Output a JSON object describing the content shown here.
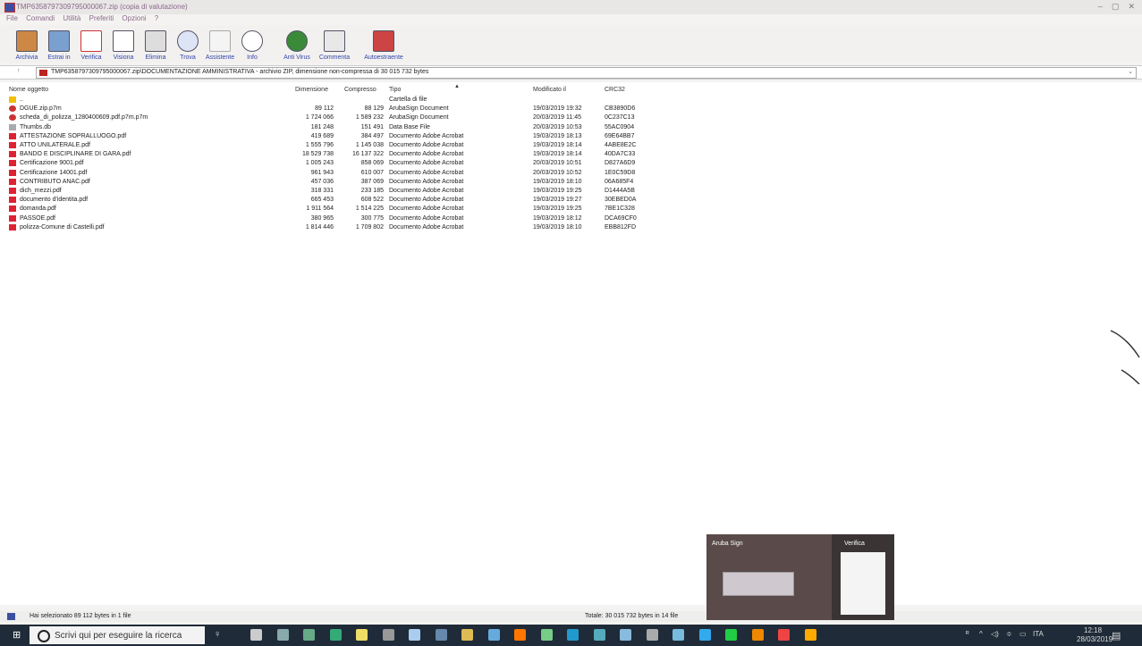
{
  "window": {
    "title": "TMP6358797309795000067.zip (copia di valutazione)",
    "controls": [
      "–",
      "▢",
      "✕"
    ]
  },
  "menu": [
    "File",
    "Comandi",
    "Utilità",
    "Preferiti",
    "Opzioni",
    "?"
  ],
  "toolbar": [
    {
      "label": "Archivia",
      "icon": "archive-icon"
    },
    {
      "label": "Estrai in",
      "icon": "extract-folder-icon"
    },
    {
      "label": "Verifica",
      "icon": "verify-icon"
    },
    {
      "label": "Visiona",
      "icon": "view-icon"
    },
    {
      "label": "Elimina",
      "icon": "trash-icon"
    },
    {
      "label": "Trova",
      "icon": "magnifier-icon"
    },
    {
      "label": "Assistente",
      "icon": "wizard-icon"
    },
    {
      "label": "Info",
      "icon": "info-icon"
    },
    {
      "label": "Anti Virus",
      "icon": "antivirus-icon"
    },
    {
      "label": "Commenta",
      "icon": "comment-icon"
    },
    {
      "label": "Autoestraente",
      "icon": "sfx-icon"
    }
  ],
  "address": {
    "path": "TMP6358797309795000067.zip\\DOCUMENTAZIONE AMMINISTRATIVA - archivio ZIP, dimensione non-compressa di 30 015 732 bytes"
  },
  "columns": {
    "name": "Nome oggetto",
    "size": "Dimensione",
    "packed": "Compresso",
    "type": "Tipo",
    "modified": "Modificato il",
    "crc": "CRC32"
  },
  "rows": [
    {
      "icon": "folder",
      "name": "..",
      "size": "",
      "packed": "",
      "type": "Cartella di file",
      "modified": "",
      "crc": ""
    },
    {
      "icon": "p7m",
      "name": "DGUE.zip.p7m",
      "size": "89 112",
      "packed": "88 129",
      "type": "ArubaSign Document",
      "modified": "19/03/2019 19:32",
      "crc": "CB3890D6"
    },
    {
      "icon": "p7m",
      "name": "scheda_di_polizza_1280400609.pdf.p7m.p7m",
      "size": "1 724 066",
      "packed": "1 589 232",
      "type": "ArubaSign Document",
      "modified": "20/03/2019 11:45",
      "crc": "0C237C13"
    },
    {
      "icon": "db",
      "name": "Thumbs.db",
      "size": "181 248",
      "packed": "151 491",
      "type": "Data Base File",
      "modified": "20/03/2019 10:53",
      "crc": "55AC0904"
    },
    {
      "icon": "pdf",
      "name": "ATTESTAZIONE SOPRALLUOGO.pdf",
      "size": "419 689",
      "packed": "384 497",
      "type": "Documento Adobe Acrobat",
      "modified": "19/03/2019 18:13",
      "crc": "69E64BB7"
    },
    {
      "icon": "pdf",
      "name": "ATTO UNILATERALE.pdf",
      "size": "1 555 796",
      "packed": "1 145 038",
      "type": "Documento Adobe Acrobat",
      "modified": "19/03/2019 18:14",
      "crc": "4ABE8E2C"
    },
    {
      "icon": "pdf",
      "name": "BANDO E DISCIPLINARE DI GARA.pdf",
      "size": "18 529 738",
      "packed": "16 137 322",
      "type": "Documento Adobe Acrobat",
      "modified": "19/03/2019 18:14",
      "crc": "40DA7C33"
    },
    {
      "icon": "pdf",
      "name": "Certificazione 9001.pdf",
      "size": "1 005 243",
      "packed": "858 069",
      "type": "Documento Adobe Acrobat",
      "modified": "20/03/2019 10:51",
      "crc": "D827A6D9"
    },
    {
      "icon": "pdf",
      "name": "Certificazione 14001.pdf",
      "size": "961 943",
      "packed": "610 007",
      "type": "Documento Adobe Acrobat",
      "modified": "20/03/2019 10:52",
      "crc": "1E0C59D8"
    },
    {
      "icon": "pdf",
      "name": "CONTRIBUTO ANAC.pdf",
      "size": "457 036",
      "packed": "387 069",
      "type": "Documento Adobe Acrobat",
      "modified": "19/03/2019 18:10",
      "crc": "06A685F4"
    },
    {
      "icon": "pdf",
      "name": "dich_mezzi.pdf",
      "size": "318 331",
      "packed": "233 185",
      "type": "Documento Adobe Acrobat",
      "modified": "19/03/2019 19:25",
      "crc": "D1444A5B"
    },
    {
      "icon": "pdf",
      "name": "documento d'identita.pdf",
      "size": "665 453",
      "packed": "608 522",
      "type": "Documento Adobe Acrobat",
      "modified": "19/03/2019 19:27",
      "crc": "30EBED0A"
    },
    {
      "icon": "pdf",
      "name": "domanda.pdf",
      "size": "1 911 564",
      "packed": "1 514 225",
      "type": "Documento Adobe Acrobat",
      "modified": "19/03/2019 19:25",
      "crc": "7BE1C328"
    },
    {
      "icon": "pdf",
      "name": "PASSOE.pdf",
      "size": "380 965",
      "packed": "300 775",
      "type": "Documento Adobe Acrobat",
      "modified": "19/03/2019 18:12",
      "crc": "DCA69CF0"
    },
    {
      "icon": "pdf",
      "name": "polizza-Comune di Castelli.pdf",
      "size": "1 814 446",
      "packed": "1 709 802",
      "type": "Documento Adobe Acrobat",
      "modified": "19/03/2019 18:10",
      "crc": "EBB812FD"
    }
  ],
  "status": {
    "left": "Hai selezionato 89 112 bytes in 1 file",
    "right": "Totale: 30 015 732 bytes in 14 file"
  },
  "taskbar": {
    "search_placeholder": "Scrivi qui per eseguire la ricerca",
    "clock_time": "12:18",
    "clock_date": "28/03/2019",
    "lang": "ITA"
  },
  "popup": {
    "left_title": "Aruba Sign",
    "right_title": "Verifica"
  },
  "colors": {
    "accent": "#3344aa",
    "taskbar": "#1f2b38",
    "pdf_icon": "#dd2233"
  }
}
